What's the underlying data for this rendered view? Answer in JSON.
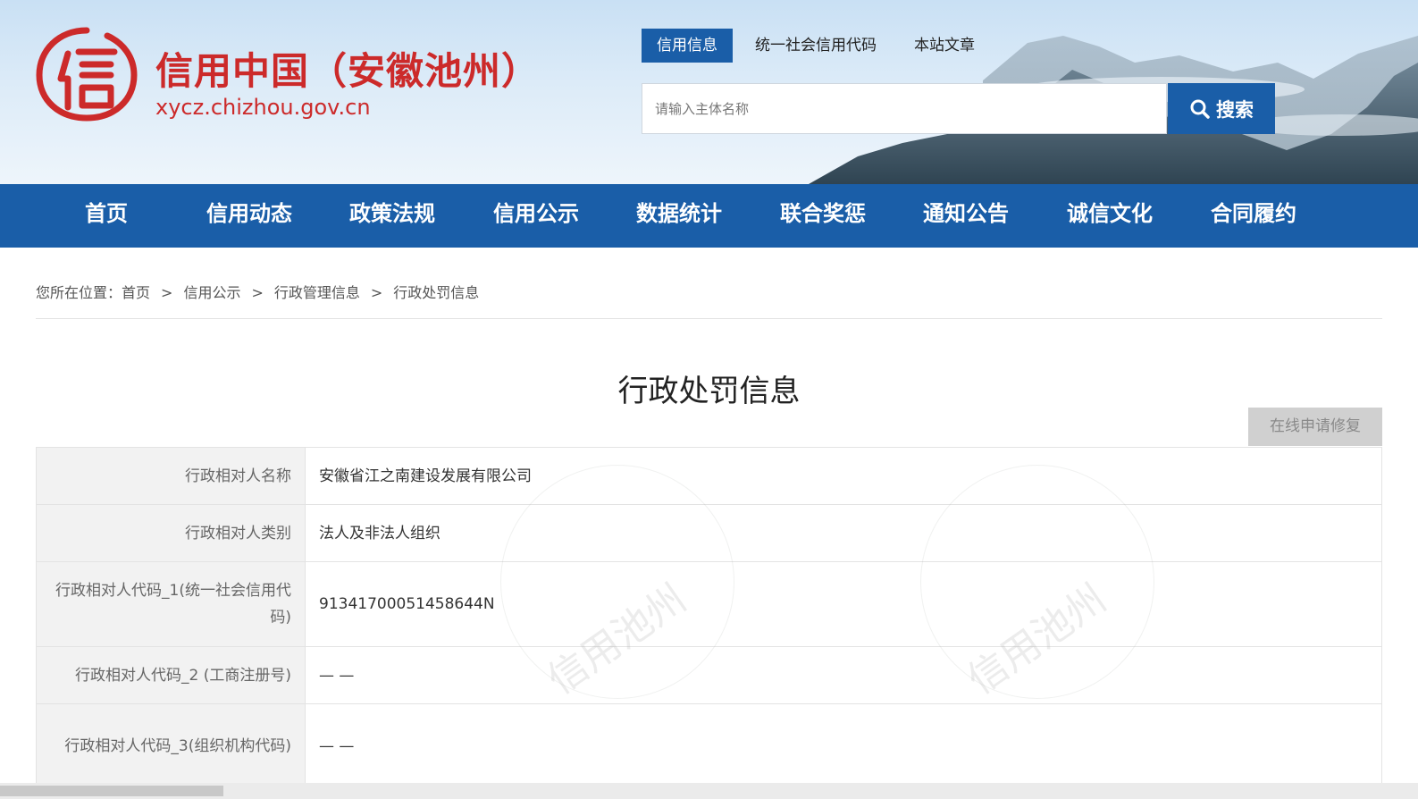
{
  "site": {
    "title": "信用中国（安徽池州）",
    "url": "xycz.chizhou.gov.cn",
    "emblem_char": "信",
    "brand_color": "#cc2a2a",
    "primary_color": "#1a5ea8"
  },
  "top_tabs": [
    {
      "label": "信用信息",
      "active": true
    },
    {
      "label": "统一社会信用代码",
      "active": false
    },
    {
      "label": "本站文章",
      "active": false
    }
  ],
  "search": {
    "placeholder": "请输入主体名称",
    "value": "",
    "button_label": "搜索",
    "icon": "search-icon"
  },
  "nav": [
    "首页",
    "信用动态",
    "政策法规",
    "信用公示",
    "数据统计",
    "联合奖惩",
    "通知公告",
    "诚信文化",
    "合同履约"
  ],
  "breadcrumb": {
    "prefix": "您所在位置：",
    "sep": ">",
    "items": [
      "首页",
      "信用公示",
      "行政管理信息",
      "行政处罚信息"
    ]
  },
  "page_title": "行政处罚信息",
  "repair_button": "在线申请修复",
  "watermark_text": "信用池州",
  "table": [
    {
      "label": "行政相对人名称",
      "value": "安徽省江之南建设发展有限公司"
    },
    {
      "label": "行政相对人类别",
      "value": "法人及非法人组织"
    },
    {
      "label": "行政相对人代码_1(统一社会信用代码)",
      "value": "91341700051458644N"
    },
    {
      "label": "行政相对人代码_2 (工商注册号)",
      "value": "— —"
    },
    {
      "label": "行政相对人代码_3(组织机构代码)",
      "value": "— —"
    }
  ]
}
